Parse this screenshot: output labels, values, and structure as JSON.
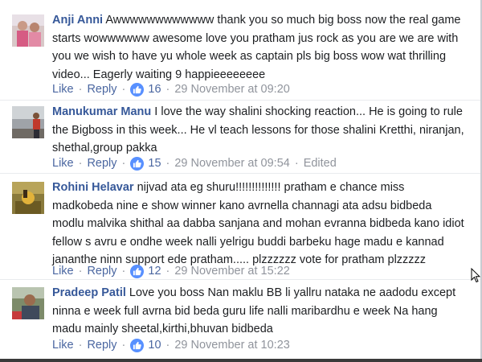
{
  "comments": [
    {
      "author": "Anji Anni",
      "text": "Awwwwwwwwwwww thank you so much big boss now the real game starts wowwwwww awesome love you pratham jus rock as you are we are with you we wish to have yu whole week as captain pls big boss wow wat thrilling video... Eagerly waiting 9 happieeeeeeee",
      "like_label": "Like",
      "reply_label": "Reply",
      "likes": "16",
      "timestamp": "29 November at 09:20",
      "edited": ""
    },
    {
      "author": "Manukumar Manu",
      "text": "I love the way shalini shocking reaction... He is going to rule the Bigboss in this week... He vl teach lessons for those shalini Kretthi, niranjan, shethal,group pakka",
      "like_label": "Like",
      "reply_label": "Reply",
      "likes": "15",
      "timestamp": "29 November at 09:54",
      "edited": "Edited"
    },
    {
      "author": "Rohini Helavar",
      "text": "nijvad ata eg shuru!!!!!!!!!!!!!! pratham e chance miss madkobeda nine e show winner kano avrnella channagi ata adsu bidbeda modlu malvika shithal aa dabba sanjana and mohan evranna bidbeda kano idiot fellow s avru e ondhe week nalli yelrigu buddi barbeku hage madu e kannad jananthe ninn support ede pratham..... plzzzzzz vote for pratham plzzzzz",
      "like_label": "Like",
      "reply_label": "Reply",
      "likes": "12",
      "timestamp": "29 November at 15:22",
      "edited": ""
    },
    {
      "author": "Pradeep Patil",
      "text": "Love you boss Nan maklu BB li yallru nataka ne aadodu except ninna e week full avrna bid beda guru life nalli maribardhu e week Na hang madu mainly sheetal,kirthi,bhuvan bidbeda",
      "like_label": "Like",
      "reply_label": "Reply",
      "likes": "10",
      "timestamp": "29 November at 10:23",
      "edited": ""
    }
  ],
  "separator": "·",
  "colors": {
    "author": "#365899",
    "link": "#4b67a1",
    "meta": "#90949c",
    "like_badge": "#5890ff"
  }
}
